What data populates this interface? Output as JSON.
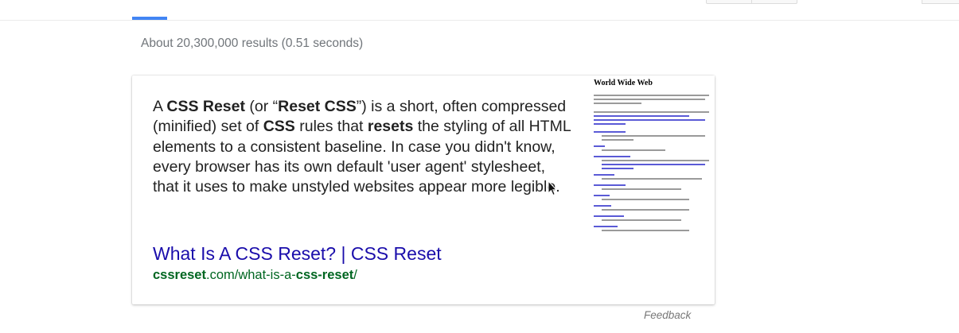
{
  "stats": {
    "text": "About 20,300,000 results (0.51 seconds)"
  },
  "snippet": {
    "parts": {
      "p1": "A ",
      "b1": "CSS Reset",
      "p2": " (or “",
      "b2": "Reset CSS",
      "p3": "”) is a short, often compressed (minified) set of ",
      "b3": "CSS",
      "p4": " rules that ",
      "b4": "resets",
      "p5": " the styling of all HTML elements to a consistent baseline. In case you didn't know, every browser has its own default 'user agent' stylesheet, that it uses to make unstyled websites appear more legible."
    },
    "title": "What Is A CSS Reset? | CSS Reset",
    "url": {
      "b1": "cssreset",
      "p1": ".com/what-is-a-",
      "b2": "css-reset",
      "p2": "/"
    },
    "thumbnail": {
      "title": "World Wide Web"
    }
  },
  "feedback": {
    "label": "Feedback"
  },
  "colors": {
    "accent": "#4285f4",
    "link": "#1a0dab",
    "url": "#006621",
    "stats": "#70757a"
  },
  "icons": {
    "cursor": "mouse-pointer-icon"
  }
}
